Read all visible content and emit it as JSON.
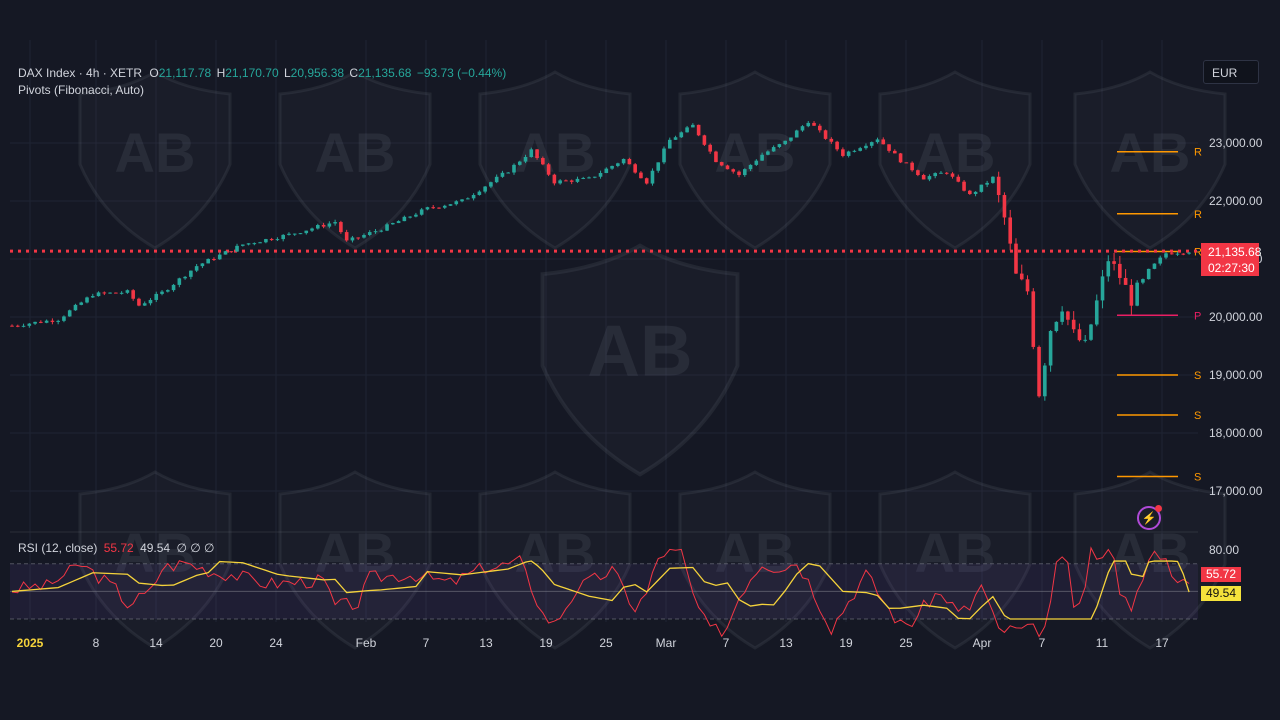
{
  "header": {
    "symbol": "DAX Index · 4h · XETR",
    "o_label": "O",
    "o_value": "21,117.78",
    "h_label": "H",
    "h_value": "21,170.70",
    "l_label": "L",
    "l_value": "20,956.38",
    "c_label": "C",
    "c_value": "21,135.68",
    "change": "−93.73 (−0.44%)",
    "indicator": "Pivots (Fibonacci, Auto)"
  },
  "rsi_header": {
    "label": "RSI (12, close)",
    "rsi_value": "55.72",
    "ma_value": "49.54",
    "extra": "∅  ∅  ∅"
  },
  "currency": "EUR",
  "last_price_tag": {
    "price": "21,135.68",
    "countdown": "02:27:30"
  },
  "rsi_tags": {
    "rsi": "55.72",
    "ma": "49.54"
  },
  "colors": {
    "background": "#151824",
    "up": "#26a69a",
    "down": "#f23645",
    "pivot_resistance": "#ff9800",
    "pivot_p": "#e91e63",
    "rsi_line": "#f23645",
    "rsi_ma": "#f5d33b",
    "rsi_band": "#7e57c2"
  },
  "icons": {
    "alert": "lightning-bolt-icon"
  },
  "chart_data": [
    {
      "type": "candlestick",
      "title": "DAX Index · 4h · XETR",
      "y_axis_ticks": [
        "23,000.00",
        "22,000.00",
        "21,000.00",
        "20,000.00",
        "19,000.00",
        "18,000.00",
        "17,000.00"
      ],
      "y_tick_values": [
        23000,
        22000,
        21000,
        20000,
        19000,
        18000,
        17000
      ],
      "ylim": [
        16400,
        24000
      ],
      "x_ticks": [
        "2025",
        "8",
        "14",
        "20",
        "24",
        "Feb",
        "7",
        "13",
        "19",
        "25",
        "Mar",
        "7",
        "13",
        "19",
        "25",
        "Apr",
        "7",
        "11",
        "17"
      ],
      "grid": true,
      "last_price": 21135.68,
      "close_path": [
        {
          "t": 0,
          "v": 19850
        },
        {
          "t": 8,
          "v": 19960
        },
        {
          "t": 14,
          "v": 20390
        },
        {
          "t": 20,
          "v": 20430
        },
        {
          "t": 22,
          "v": 20200
        },
        {
          "t": 26,
          "v": 20420
        },
        {
          "t": 32,
          "v": 20880
        },
        {
          "t": 40,
          "v": 21250
        },
        {
          "t": 48,
          "v": 21420
        },
        {
          "t": 56,
          "v": 21640
        },
        {
          "t": 58,
          "v": 21300
        },
        {
          "t": 64,
          "v": 21520
        },
        {
          "t": 72,
          "v": 21870
        },
        {
          "t": 78,
          "v": 22000
        },
        {
          "t": 86,
          "v": 22520
        },
        {
          "t": 90,
          "v": 22870
        },
        {
          "t": 94,
          "v": 22330
        },
        {
          "t": 100,
          "v": 22380
        },
        {
          "t": 106,
          "v": 22720
        },
        {
          "t": 110,
          "v": 22330
        },
        {
          "t": 114,
          "v": 23050
        },
        {
          "t": 118,
          "v": 23300
        },
        {
          "t": 122,
          "v": 22700
        },
        {
          "t": 126,
          "v": 22450
        },
        {
          "t": 130,
          "v": 22800
        },
        {
          "t": 134,
          "v": 23020
        },
        {
          "t": 138,
          "v": 23380
        },
        {
          "t": 144,
          "v": 22800
        },
        {
          "t": 150,
          "v": 23080
        },
        {
          "t": 154,
          "v": 22700
        },
        {
          "t": 158,
          "v": 22400
        },
        {
          "t": 162,
          "v": 22500
        },
        {
          "t": 166,
          "v": 22100
        },
        {
          "t": 170,
          "v": 22400
        },
        {
          "t": 172,
          "v": 21700
        },
        {
          "t": 174,
          "v": 20700
        },
        {
          "t": 176,
          "v": 20450
        },
        {
          "t": 178,
          "v": 18700
        },
        {
          "t": 180,
          "v": 19800
        },
        {
          "t": 182,
          "v": 20200
        },
        {
          "t": 184,
          "v": 19700
        },
        {
          "t": 186,
          "v": 19500
        },
        {
          "t": 190,
          "v": 21000
        },
        {
          "t": 192,
          "v": 20700
        },
        {
          "t": 194,
          "v": 20300
        },
        {
          "t": 197,
          "v": 20800
        },
        {
          "t": 200,
          "v": 21100
        },
        {
          "t": 204,
          "v": 21136
        }
      ],
      "pivot_levels": [
        {
          "label": "R",
          "value": 22850,
          "color": "#ff9800"
        },
        {
          "label": "R",
          "value": 21780,
          "color": "#ff9800"
        },
        {
          "label": "R",
          "value": 21130,
          "color": "#ff9800"
        },
        {
          "label": "P",
          "value": 20030,
          "color": "#e91e63"
        },
        {
          "label": "S",
          "value": 19000,
          "color": "#ff9800"
        },
        {
          "label": "S",
          "value": 18310,
          "color": "#ff9800"
        },
        {
          "label": "S",
          "value": 17250,
          "color": "#ff9800"
        }
      ]
    },
    {
      "type": "line",
      "title": "RSI (12, close)",
      "y_axis_ticks": [
        "80.00"
      ],
      "band": [
        30,
        70
      ],
      "ylim": [
        20,
        85
      ],
      "series": [
        {
          "name": "RSI",
          "last": 55.72
        },
        {
          "name": "MA",
          "last": 49.54
        }
      ]
    }
  ]
}
